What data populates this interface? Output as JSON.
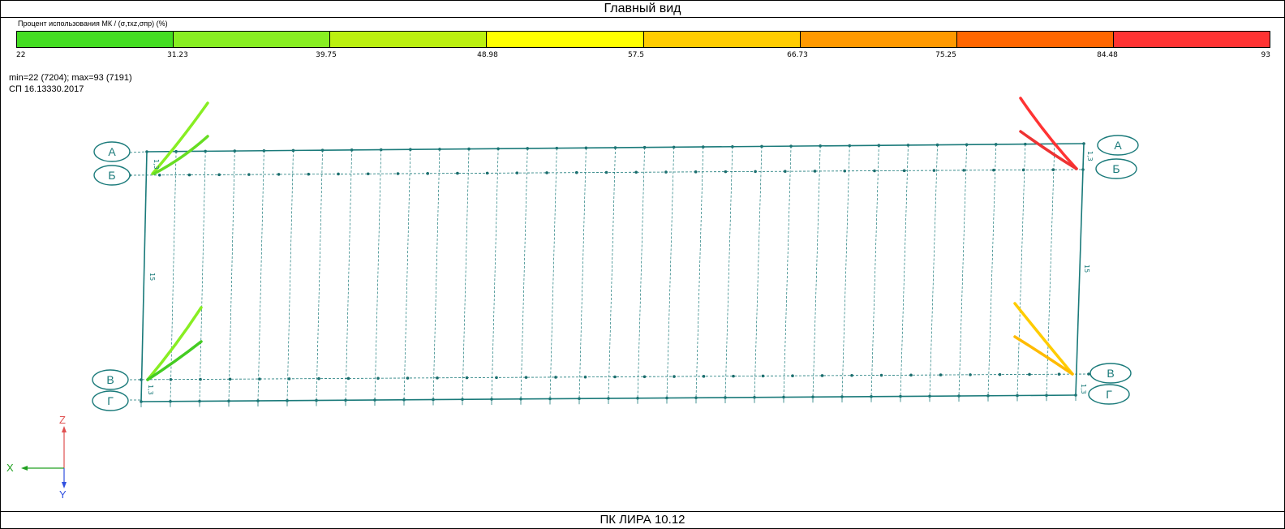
{
  "window": {
    "title": "Главный вид"
  },
  "legend": {
    "caption": "Процент использования МК / (σ,τxz,σпр) (%)",
    "colors": [
      "#44dd22",
      "#88ee22",
      "#bbf010",
      "#ffff00",
      "#ffcc00",
      "#ff9900",
      "#ff6600",
      "#ff3333"
    ],
    "labels": [
      "22",
      "31.23",
      "39.75",
      "48.98",
      "57.5",
      "66.73",
      "75.25",
      "84.48",
      "93"
    ]
  },
  "info": {
    "minmax": "min=22 (7204); max=93 (7191)",
    "code": "СП 16.13330.2017"
  },
  "axes": {
    "a": {
      "label": "А"
    },
    "b": {
      "label": "Б"
    },
    "v": {
      "label": "В"
    },
    "g": {
      "label": "Г"
    },
    "span_top": "1,3",
    "span_middle": "15",
    "span_bottom": "1,3"
  },
  "members": {
    "top_left_colors": [
      "#88ee22",
      "#66dd22"
    ],
    "top_right_colors": [
      "#ff3333",
      "#ee3333"
    ],
    "bottom_left_colors": [
      "#88ee22",
      "#44cc22"
    ],
    "bottom_right_colors": [
      "#ffcc00",
      "#ffbb00"
    ]
  },
  "triad": {
    "z": "Z",
    "x": "X",
    "y": "Y",
    "z_color": "#e05050",
    "x_color": "#20a020",
    "y_color": "#3050e0"
  },
  "status": {
    "text": "ПК ЛИРА 10.12"
  }
}
